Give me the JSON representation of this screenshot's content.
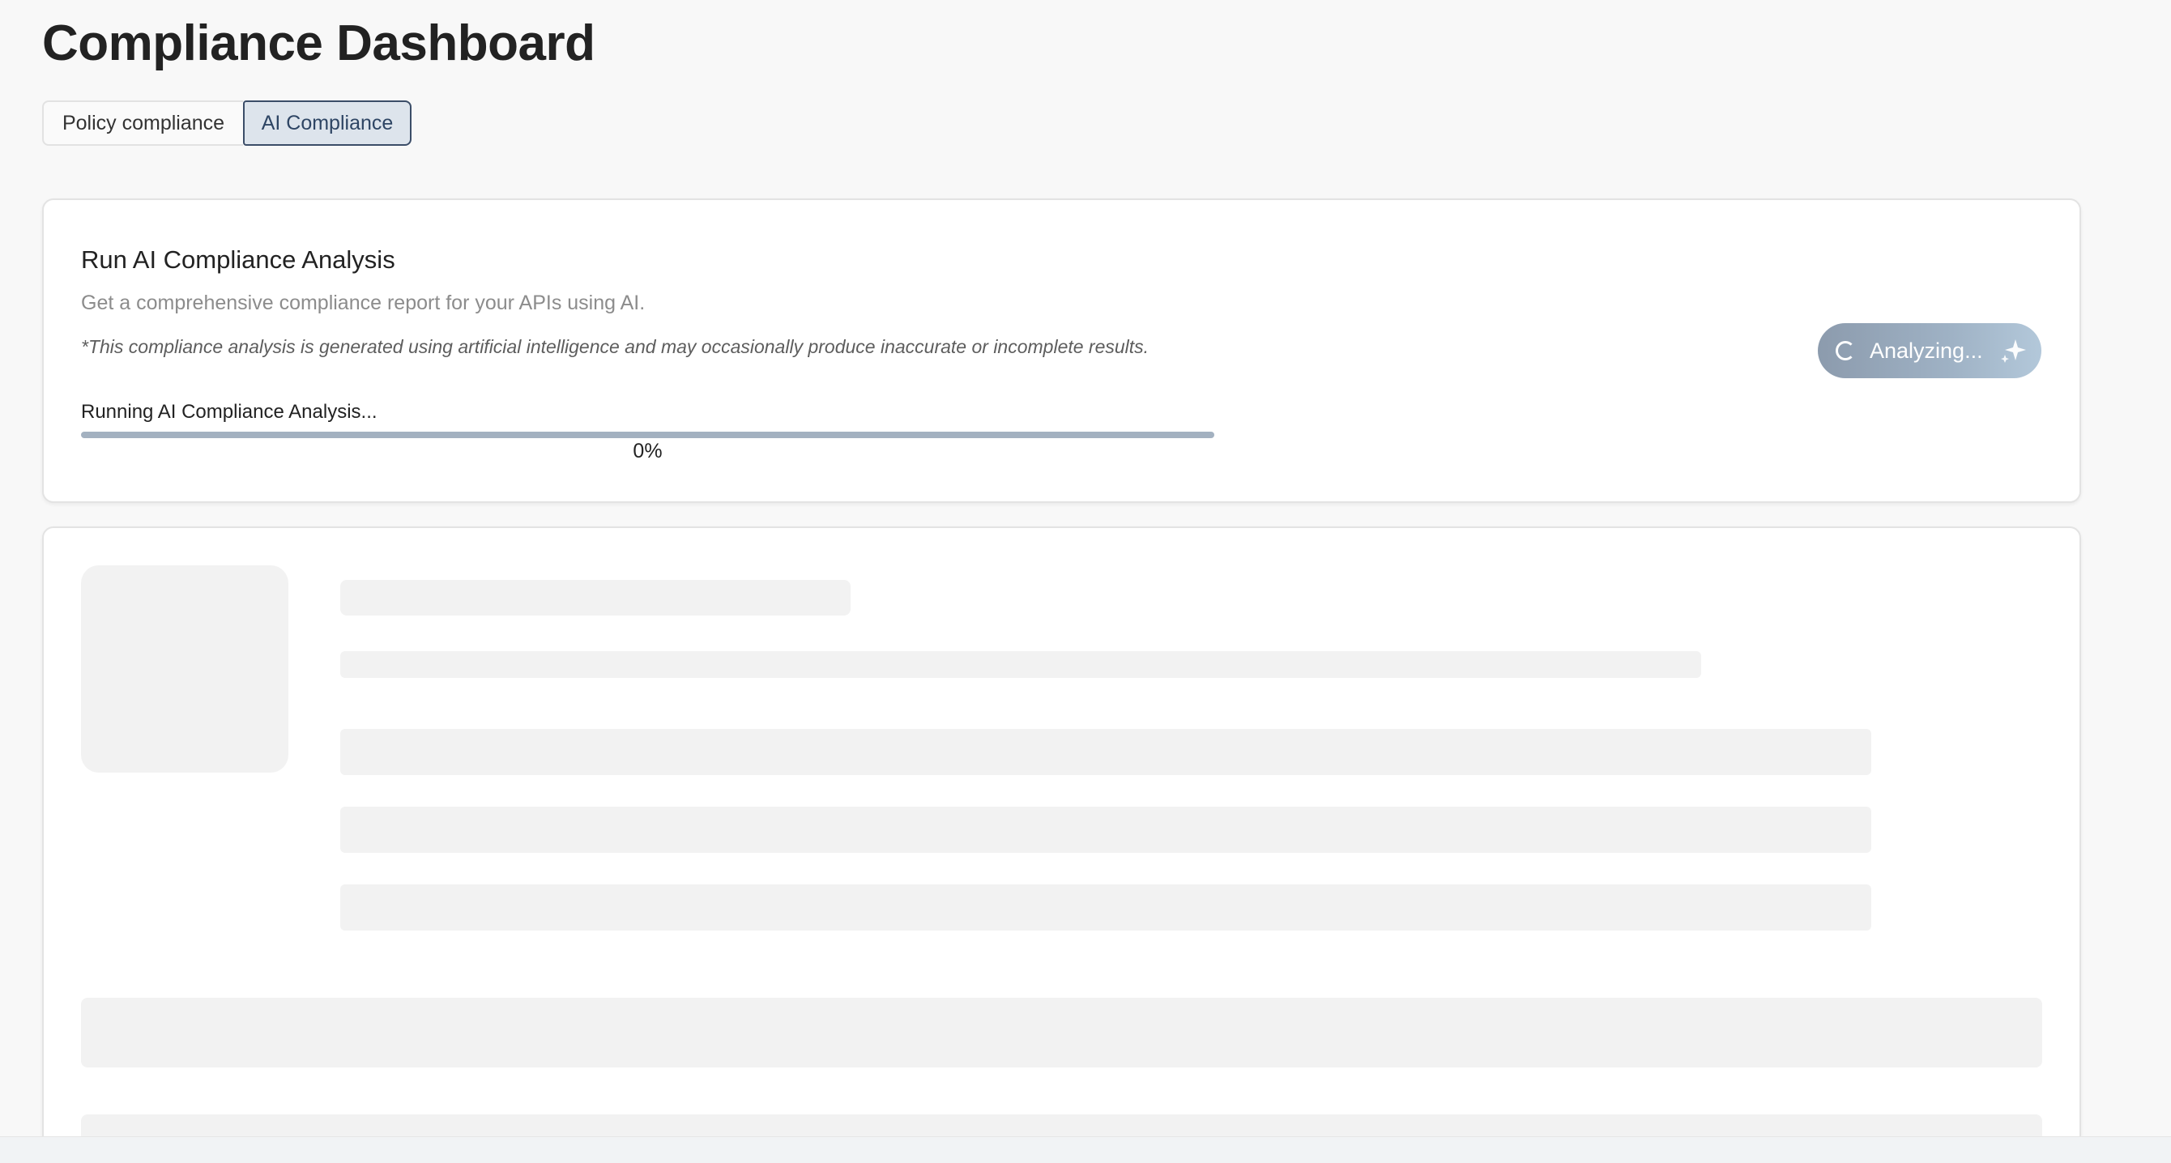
{
  "header": {
    "title": "Compliance Dashboard"
  },
  "tabs": [
    {
      "label": "Policy compliance",
      "active": false
    },
    {
      "label": "AI Compliance",
      "active": true
    }
  ],
  "analysis": {
    "title": "Run AI Compliance Analysis",
    "subtitle": "Get a comprehensive compliance report for your APIs using AI.",
    "disclaimer": "*This compliance analysis is generated using artificial intelligence and may occasionally produce inaccurate or incomplete results.",
    "progress_label": "Running AI Compliance Analysis...",
    "progress_percent_text": "0%",
    "progress_value": 0,
    "button_label": "Analyzing...",
    "button_icon": "spinner-icon",
    "button_trailing_icon": "sparkle-icon"
  },
  "results": {
    "state": "loading"
  },
  "colors": {
    "accent": "#3b4d68",
    "active_tab_bg": "#dde4ec",
    "progress_track": "#a3b1c0",
    "skeleton": "#f2f2f2",
    "page_bg": "#f8f8f8"
  }
}
